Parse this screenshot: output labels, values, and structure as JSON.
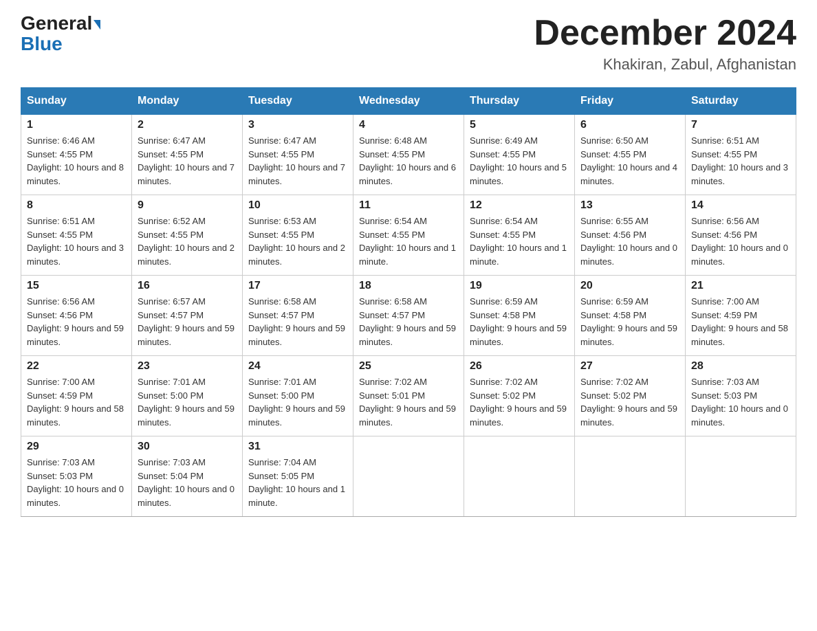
{
  "header": {
    "logo_general": "General",
    "logo_blue": "Blue",
    "title": "December 2024",
    "subtitle": "Khakiran, Zabul, Afghanistan"
  },
  "days_of_week": [
    "Sunday",
    "Monday",
    "Tuesday",
    "Wednesday",
    "Thursday",
    "Friday",
    "Saturday"
  ],
  "weeks": [
    [
      {
        "day": "1",
        "sunrise": "6:46 AM",
        "sunset": "4:55 PM",
        "daylight": "10 hours and 8 minutes."
      },
      {
        "day": "2",
        "sunrise": "6:47 AM",
        "sunset": "4:55 PM",
        "daylight": "10 hours and 7 minutes."
      },
      {
        "day": "3",
        "sunrise": "6:47 AM",
        "sunset": "4:55 PM",
        "daylight": "10 hours and 7 minutes."
      },
      {
        "day": "4",
        "sunrise": "6:48 AM",
        "sunset": "4:55 PM",
        "daylight": "10 hours and 6 minutes."
      },
      {
        "day": "5",
        "sunrise": "6:49 AM",
        "sunset": "4:55 PM",
        "daylight": "10 hours and 5 minutes."
      },
      {
        "day": "6",
        "sunrise": "6:50 AM",
        "sunset": "4:55 PM",
        "daylight": "10 hours and 4 minutes."
      },
      {
        "day": "7",
        "sunrise": "6:51 AM",
        "sunset": "4:55 PM",
        "daylight": "10 hours and 3 minutes."
      }
    ],
    [
      {
        "day": "8",
        "sunrise": "6:51 AM",
        "sunset": "4:55 PM",
        "daylight": "10 hours and 3 minutes."
      },
      {
        "day": "9",
        "sunrise": "6:52 AM",
        "sunset": "4:55 PM",
        "daylight": "10 hours and 2 minutes."
      },
      {
        "day": "10",
        "sunrise": "6:53 AM",
        "sunset": "4:55 PM",
        "daylight": "10 hours and 2 minutes."
      },
      {
        "day": "11",
        "sunrise": "6:54 AM",
        "sunset": "4:55 PM",
        "daylight": "10 hours and 1 minute."
      },
      {
        "day": "12",
        "sunrise": "6:54 AM",
        "sunset": "4:55 PM",
        "daylight": "10 hours and 1 minute."
      },
      {
        "day": "13",
        "sunrise": "6:55 AM",
        "sunset": "4:56 PM",
        "daylight": "10 hours and 0 minutes."
      },
      {
        "day": "14",
        "sunrise": "6:56 AM",
        "sunset": "4:56 PM",
        "daylight": "10 hours and 0 minutes."
      }
    ],
    [
      {
        "day": "15",
        "sunrise": "6:56 AM",
        "sunset": "4:56 PM",
        "daylight": "9 hours and 59 minutes."
      },
      {
        "day": "16",
        "sunrise": "6:57 AM",
        "sunset": "4:57 PM",
        "daylight": "9 hours and 59 minutes."
      },
      {
        "day": "17",
        "sunrise": "6:58 AM",
        "sunset": "4:57 PM",
        "daylight": "9 hours and 59 minutes."
      },
      {
        "day": "18",
        "sunrise": "6:58 AM",
        "sunset": "4:57 PM",
        "daylight": "9 hours and 59 minutes."
      },
      {
        "day": "19",
        "sunrise": "6:59 AM",
        "sunset": "4:58 PM",
        "daylight": "9 hours and 59 minutes."
      },
      {
        "day": "20",
        "sunrise": "6:59 AM",
        "sunset": "4:58 PM",
        "daylight": "9 hours and 59 minutes."
      },
      {
        "day": "21",
        "sunrise": "7:00 AM",
        "sunset": "4:59 PM",
        "daylight": "9 hours and 58 minutes."
      }
    ],
    [
      {
        "day": "22",
        "sunrise": "7:00 AM",
        "sunset": "4:59 PM",
        "daylight": "9 hours and 58 minutes."
      },
      {
        "day": "23",
        "sunrise": "7:01 AM",
        "sunset": "5:00 PM",
        "daylight": "9 hours and 59 minutes."
      },
      {
        "day": "24",
        "sunrise": "7:01 AM",
        "sunset": "5:00 PM",
        "daylight": "9 hours and 59 minutes."
      },
      {
        "day": "25",
        "sunrise": "7:02 AM",
        "sunset": "5:01 PM",
        "daylight": "9 hours and 59 minutes."
      },
      {
        "day": "26",
        "sunrise": "7:02 AM",
        "sunset": "5:02 PM",
        "daylight": "9 hours and 59 minutes."
      },
      {
        "day": "27",
        "sunrise": "7:02 AM",
        "sunset": "5:02 PM",
        "daylight": "9 hours and 59 minutes."
      },
      {
        "day": "28",
        "sunrise": "7:03 AM",
        "sunset": "5:03 PM",
        "daylight": "10 hours and 0 minutes."
      }
    ],
    [
      {
        "day": "29",
        "sunrise": "7:03 AM",
        "sunset": "5:03 PM",
        "daylight": "10 hours and 0 minutes."
      },
      {
        "day": "30",
        "sunrise": "7:03 AM",
        "sunset": "5:04 PM",
        "daylight": "10 hours and 0 minutes."
      },
      {
        "day": "31",
        "sunrise": "7:04 AM",
        "sunset": "5:05 PM",
        "daylight": "10 hours and 1 minute."
      },
      null,
      null,
      null,
      null
    ]
  ]
}
